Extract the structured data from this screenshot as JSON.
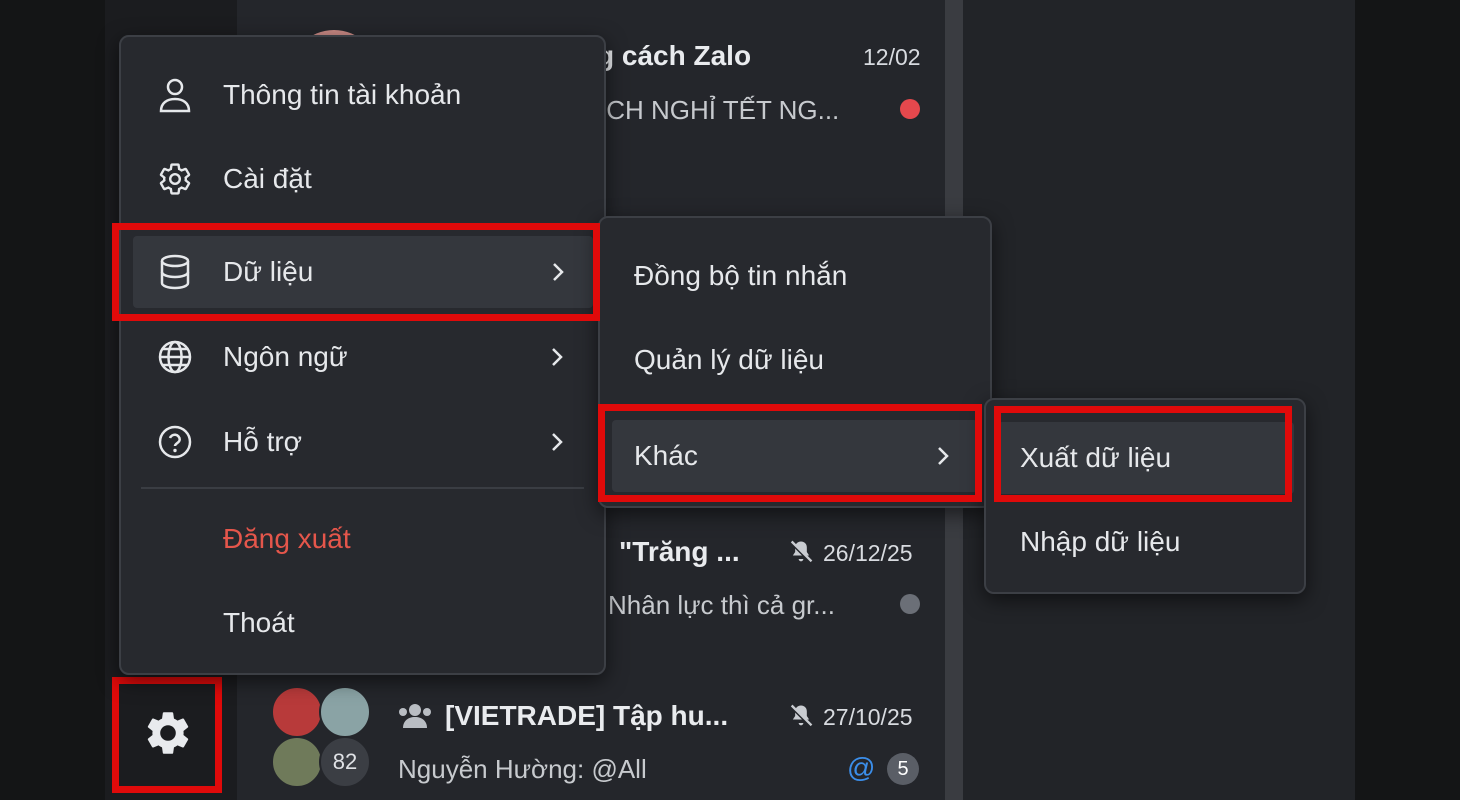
{
  "conversations": [
    {
      "title_fragment": "g cách Zalo",
      "date": "12/02",
      "preview_fragment": "ỊCH NGHỈ TẾT NG...",
      "unread_color": "#e5484d"
    },
    {
      "title_fragment": "\"Trăng ...",
      "date": "26/12/25",
      "preview_fragment": "Nhân lực thì cả gr...",
      "muted": true,
      "dot_color": "#6b6f77"
    },
    {
      "title": "[VIETRADE] Tập hu...",
      "date": "27/10/25",
      "preview": "Nguyễn Hường: @All",
      "member_count": "82",
      "mention_icon": "@",
      "unread_count": "5",
      "muted": true,
      "is_group": true
    }
  ],
  "settings_menu": {
    "items": [
      {
        "label": "Thông tin tài khoản",
        "icon": "user-icon"
      },
      {
        "label": "Cài đặt",
        "icon": "gear-icon"
      },
      {
        "label": "Dữ liệu",
        "icon": "database-icon",
        "has_submenu": true,
        "highlighted": true
      },
      {
        "label": "Ngôn ngữ",
        "icon": "globe-icon",
        "has_submenu": true
      },
      {
        "label": "Hỗ trợ",
        "icon": "help-icon",
        "has_submenu": true
      },
      {
        "label": "Đăng xuất",
        "danger": true
      },
      {
        "label": "Thoát"
      }
    ],
    "danger_color": "#e5564b"
  },
  "data_submenu": {
    "items": [
      {
        "label": "Đồng bộ tin nhắn"
      },
      {
        "label": "Quản lý dữ liệu"
      },
      {
        "label": "Khác",
        "has_submenu": true,
        "highlighted": true
      }
    ]
  },
  "other_submenu": {
    "items": [
      {
        "label": "Xuất dữ liệu",
        "highlighted": true
      },
      {
        "label": "Nhập dữ liệu"
      }
    ]
  },
  "settings_button": {
    "icon": "gear-icon",
    "highlighted": true
  },
  "highlight_color": "#e00a0a"
}
